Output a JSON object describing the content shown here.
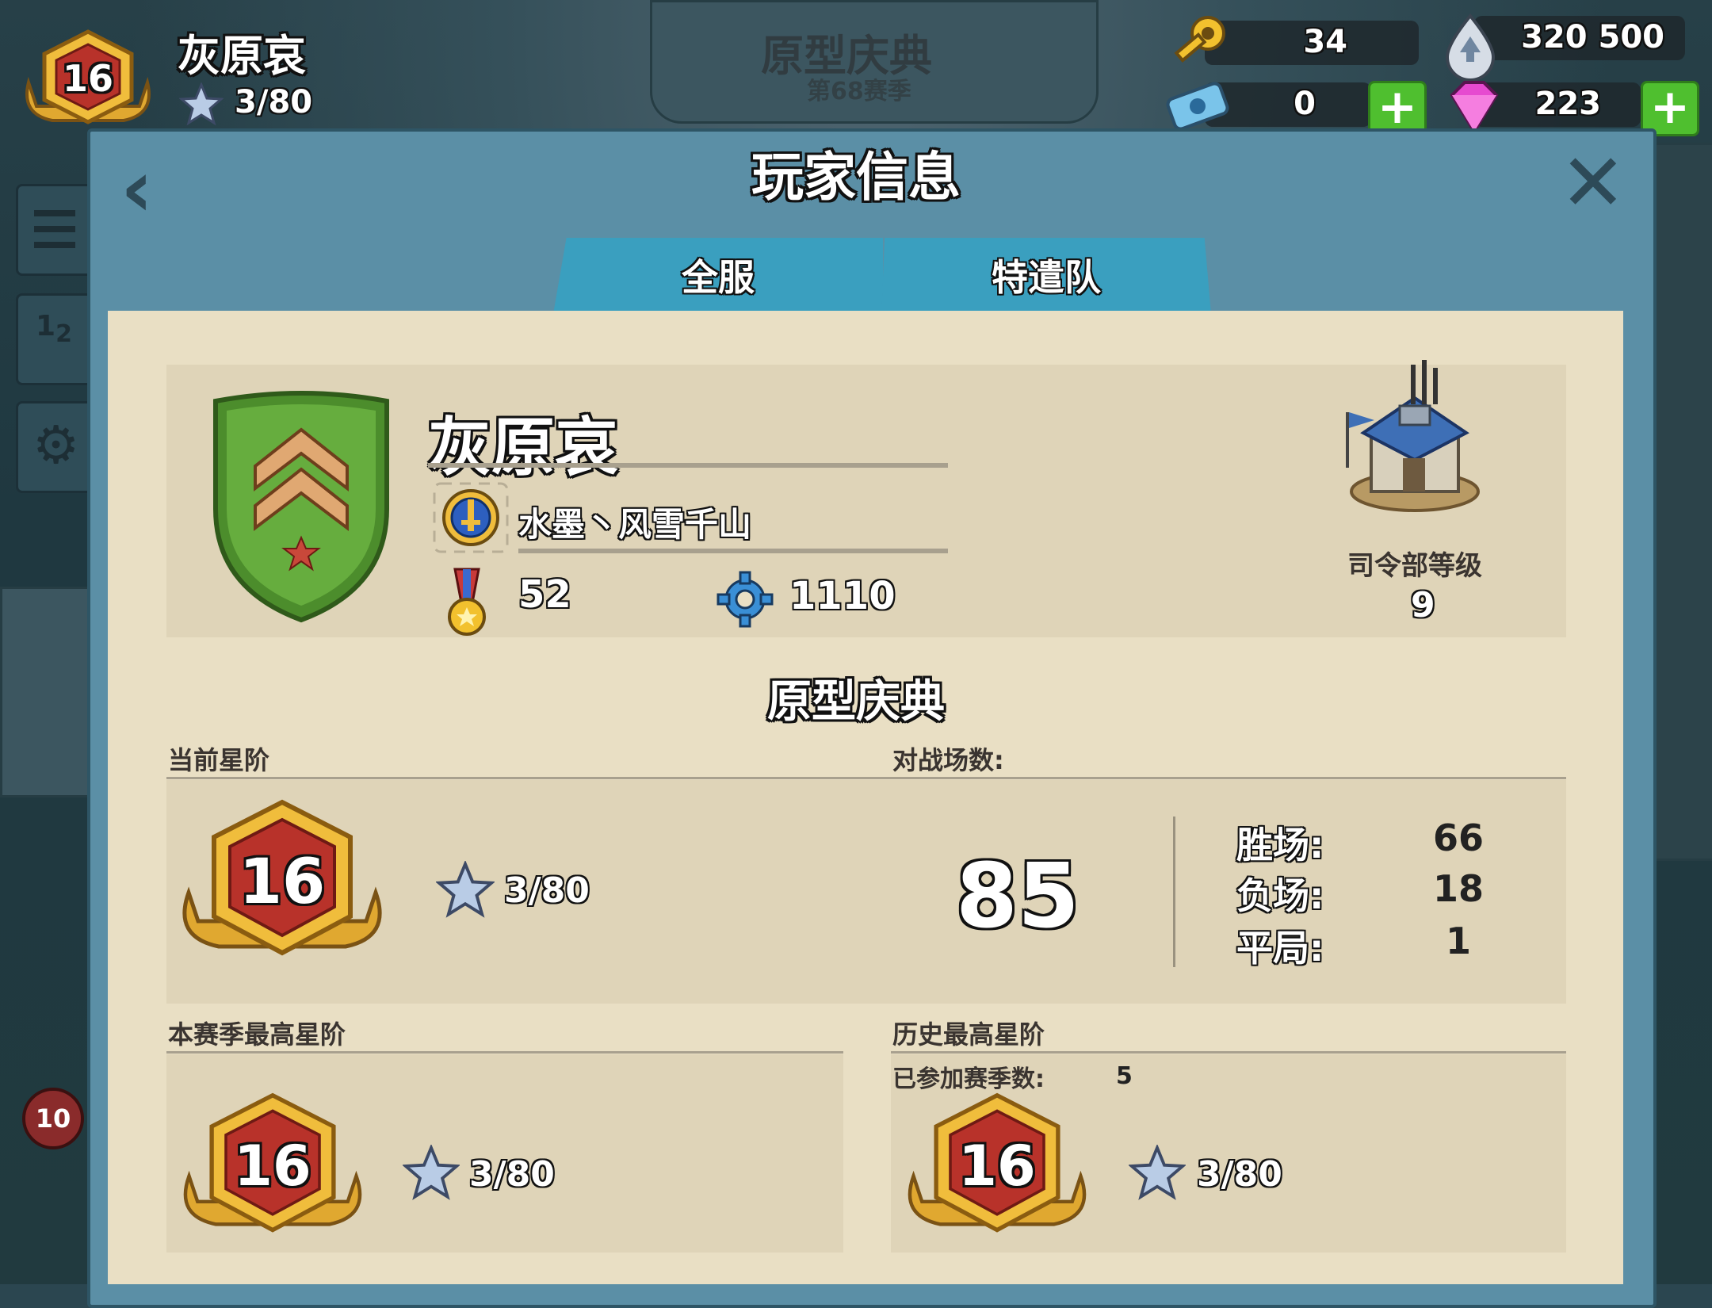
{
  "top_bar": {
    "level": "16",
    "player_name": "灰原哀",
    "stars": "3/80",
    "season_title": "原型庆典",
    "season_number": "第68赛季",
    "resources": {
      "keys": "34",
      "intel": "320 500",
      "tickets": "0",
      "diamonds": "223"
    }
  },
  "panel": {
    "title": "玩家信息",
    "tabs": [
      {
        "label": "全服"
      },
      {
        "label": "特遣队"
      }
    ]
  },
  "profile": {
    "name": "灰原哀",
    "task_force": "水墨丶风雪千山",
    "medals": "52",
    "rank_points": "1110",
    "hq_label": "司令部等级",
    "hq_level": "9"
  },
  "season": {
    "title": "原型庆典",
    "current_rank_label": "当前星阶",
    "current_rank": "16",
    "current_stars": "3/80",
    "battles_label": "对战场数:",
    "battles_total": "85",
    "wins_label": "胜场:",
    "wins": "66",
    "losses_label": "负场:",
    "losses": "18",
    "draws_label": "平局:",
    "draws": "1",
    "season_best_label": "本赛季最高星阶",
    "season_best_rank": "16",
    "season_best_stars": "3/80",
    "all_time_best_label": "历史最高星阶",
    "seasons_played_label": "已参加赛季数:",
    "seasons_played": "5",
    "all_time_best_rank": "16",
    "all_time_best_stars": "3/80"
  },
  "colors": {
    "panel_blue": "#5b8fa6",
    "tab_blue": "#3a9fbf",
    "parchment": "#e9dfc4",
    "badge_gold": "#e8b23a",
    "badge_red": "#b8322a",
    "shield_green": "#5ea33a",
    "plus_green": "#4fbf2f"
  }
}
